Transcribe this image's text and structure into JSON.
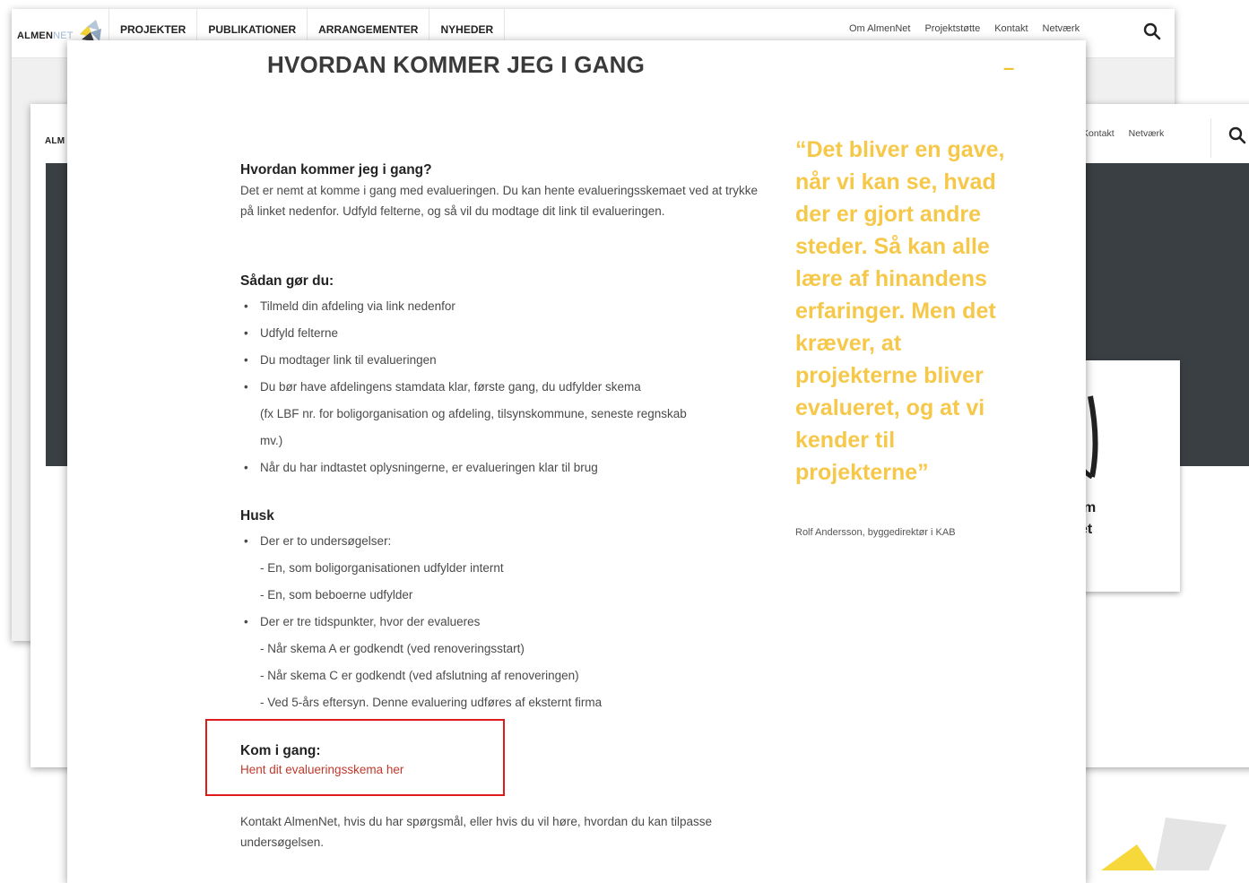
{
  "site": {
    "logo_text_a": "ALMEN",
    "logo_text_b": "NET",
    "logo_text_mid": "ALM"
  },
  "nav": {
    "main": [
      "PROJEKTER",
      "PUBLIKATIONER",
      "ARRANGEMENTER",
      "NYHEDER"
    ],
    "secondary": [
      "Om AlmenNet",
      "Projektstøtte",
      "Kontakt",
      "Netværk"
    ],
    "secondary_mid": [
      "Kontakt",
      "Netværk"
    ]
  },
  "mid_card": {
    "line1": "m",
    "line2": "et"
  },
  "page": {
    "title": "HVORDAN KOMMER JEG I GANG",
    "dash": "–",
    "intro_heading": "Hvordan kommer jeg i gang?",
    "intro_text": "Det er nemt at komme i gang med evalueringen. Du kan hente evalueringsskemaet ved at trykke på linket nedenfor. Udfyld felterne, og så vil du modtage dit link til evalueringen.",
    "how_heading": "Sådan gør du:",
    "how_items": [
      "Tilmeld din afdeling via link nedenfor",
      "Udfyld felterne",
      "Du modtager link til evalueringen",
      "Du bør have afdelingens stamdata klar, første gang, du udfylder skema",
      "(fx LBF nr. for boligorganisation og afdeling, tilsynskommune, seneste regnskab",
      "mv.)",
      "Når du har indtastet oplysningerne, er evalueringen klar til brug"
    ],
    "remember_heading": "Husk",
    "remember_items": [
      "Der er to undersøgelser:",
      "- En, som boligorganisationen udfylder internt",
      "- En, som beboerne udfylder",
      "Der er tre tidspunkter, hvor der evalueres",
      "- Når skema A er godkendt (ved renoveringsstart)",
      "- Når skema C er godkendt (ved afslutning af renoveringen)",
      "- Ved 5-års eftersyn. Denne evaluering udføres af eksternt firma"
    ],
    "start_heading": "Kom i gang:",
    "start_link": "Hent dit evalueringsskema her",
    "contact_text": "Kontakt AlmenNet, hvis du har spørgsmål, eller hvis du vil høre, hvordan du kan tilpasse undersøgelsen."
  },
  "quote": {
    "text": "“Det bliver en gave, når vi kan se, hvad der er gjort andre steder. Så kan alle lære af hinandens erfaringer. Men det kræver, at projekterne bliver evalueret, og at vi kender til projekterne”",
    "author": "Rolf Andersson, byggedirektør i KAB"
  },
  "colors": {
    "accent_yellow": "#f6c84a",
    "link_red": "#c0392b",
    "highlight_box": "#e01b1b",
    "hero_dark": "#3a3f43"
  },
  "icons": [
    "logo-mark-icon",
    "search-icon"
  ]
}
